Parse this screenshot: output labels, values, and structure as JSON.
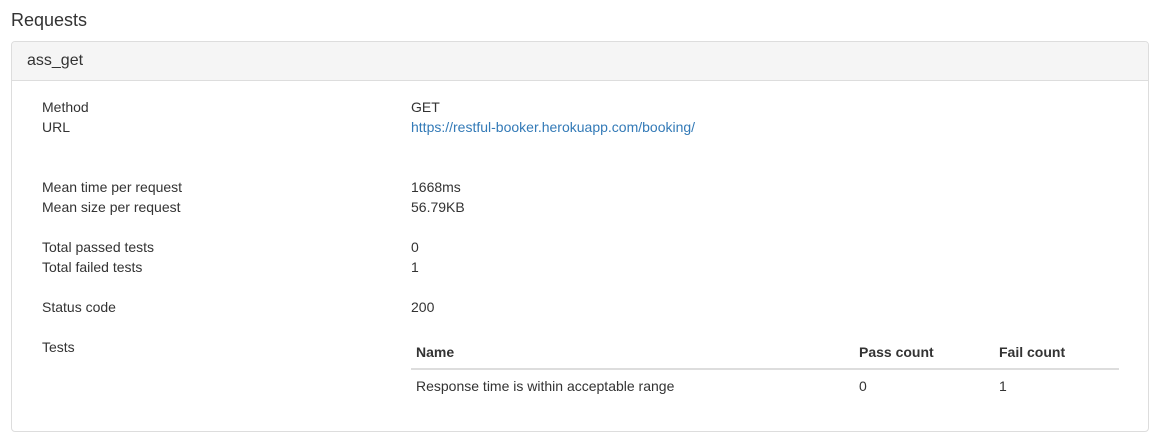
{
  "section": {
    "title": "Requests"
  },
  "request": {
    "name": "ass_get",
    "fields": {
      "method_label": "Method",
      "method_value": "GET",
      "url_label": "URL",
      "url_value": "https://restful-booker.herokuapp.com/booking/",
      "mean_time_label": "Mean time per request",
      "mean_time_value": "1668ms",
      "mean_size_label": "Mean size per request",
      "mean_size_value": "56.79KB",
      "passed_label": "Total passed tests",
      "passed_value": "0",
      "failed_label": "Total failed tests",
      "failed_value": "1",
      "status_label": "Status code",
      "status_value": "200",
      "tests_label": "Tests"
    },
    "tests_table": {
      "headers": [
        "Name",
        "Pass count",
        "Fail count"
      ],
      "rows": [
        [
          "Response time is within acceptable range",
          "0",
          "1"
        ]
      ]
    }
  },
  "colors": {
    "link": "#337ab7",
    "panel_heading_bg": "#f5f5f5",
    "border": "#dddddd",
    "text": "#333333"
  }
}
